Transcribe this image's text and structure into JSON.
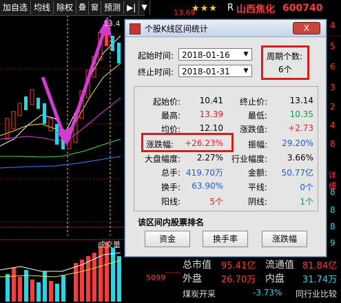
{
  "toolbar": {
    "items": [
      "加自选",
      "均线",
      "除权",
      "叠",
      "窗",
      "预测"
    ],
    "arrow_glyph": "▶|",
    "dropdown_glyph": "▼"
  },
  "header": {
    "stars": "★★★",
    "prefix": "R",
    "stock_name": "山西焦化",
    "stock_code": "600740",
    "top_price": "13.69"
  },
  "chart_overlay": {
    "high_label": "13.4",
    "volume_caption": "成交量",
    "volume_number": "5099"
  },
  "dialog": {
    "title": "个股K线区间统计",
    "close_label": "X",
    "start_label": "起始时间:",
    "start_value": "2018-01-16",
    "end_label": "终止时间:",
    "end_value": "2018-01-31",
    "period_label": "周期个数:",
    "period_value": "6个",
    "stats": {
      "open_label": "起始价:",
      "open_value": "10.41",
      "close_label": "终止价:",
      "close_value": "13.14",
      "high_label": "最高:",
      "high_value": "13.39",
      "low_label": "最低:",
      "low_value": "10.35",
      "avg_label": "均价:",
      "avg_value": "12.10",
      "change_label": "涨跌值:",
      "change_value": "+2.73",
      "pct_label": "涨跌幅:",
      "pct_value": "+26.23%",
      "amp_label": "振幅:",
      "amp_value": "29.20%",
      "market_label": "大盘幅度:",
      "market_value": "2.27%",
      "industry_label": "行业幅度:",
      "industry_value": "3.66%",
      "hands_label": "总手:",
      "hands_value": "419.70万",
      "amount_label": "金额:",
      "amount_value": "50.77亿",
      "turnover_label": "换手:",
      "turnover_value": "63.90%",
      "flat_label": "平线:",
      "flat_value": "0个",
      "up_label": "阳线:",
      "up_value": "5个",
      "down_label": "阴线:",
      "down_value": "1个"
    },
    "rank_title": "该区间内股票排名",
    "buttons": [
      "资金",
      "换手率",
      "涨跌幅"
    ]
  },
  "right_panel": {
    "row1_label": "总市值",
    "row1_value": "95.41亿",
    "row1_label2": "流通值",
    "row1_value2": "81.84亿",
    "row2_label": "外盘",
    "row2_value": "26.70万",
    "row2_label2": "内盘",
    "row2_value2": "31.74万",
    "row3_label": "煤炭开采",
    "row3_value": "-3.73%",
    "row3_label2": "同行业比较",
    "side_digits": [
      "4",
      "5",
      "6",
      "3",
      "2",
      "4",
      "8",
      "8",
      "8",
      "8",
      "9",
      "3",
      "1"
    ],
    "side_word": "详细"
  },
  "colors": {
    "up": "#ff3a3a",
    "down": "#26d6e6",
    "arrow": "#d23ad6",
    "dialog_bg": "#e5e5e5"
  }
}
